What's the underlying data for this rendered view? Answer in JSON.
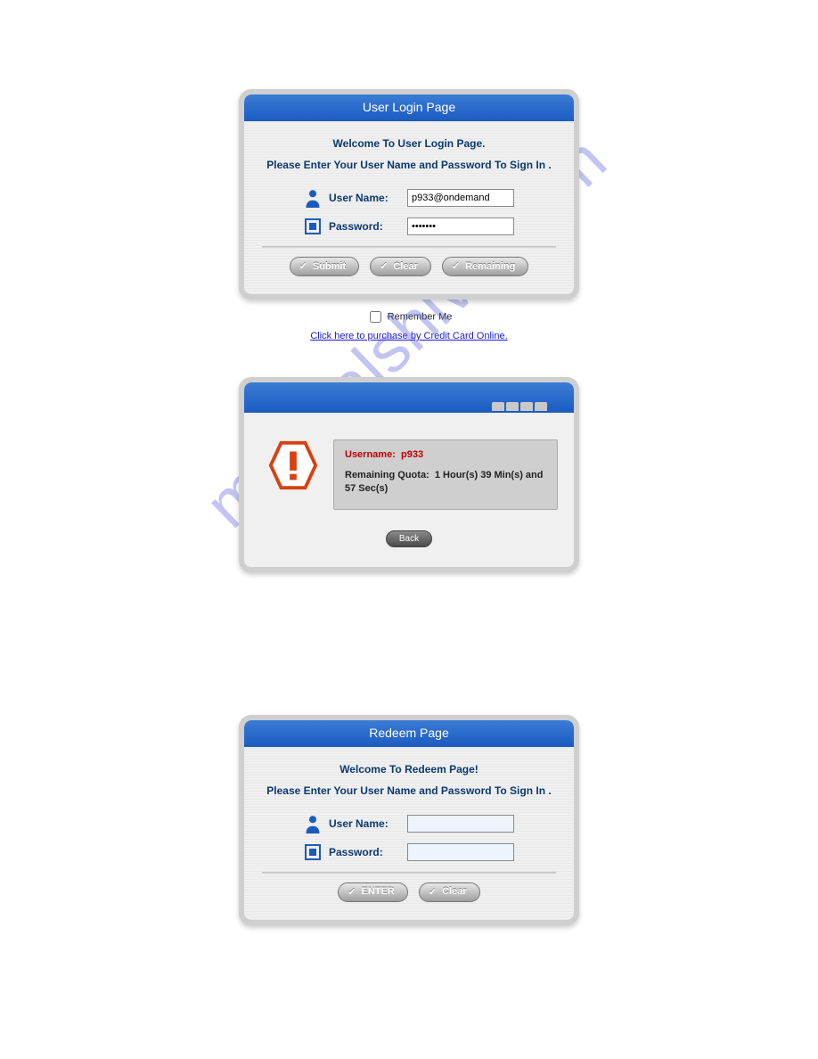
{
  "watermark": "manualshive.com",
  "panel1": {
    "title": "User Login Page",
    "welcome": "Welcome To User Login Page.",
    "instruction": "Please Enter Your User Name and Password To Sign In .",
    "username_label": "User Name:",
    "username_value": "p933@ondemand",
    "password_label": "Password:",
    "password_value": "•••••••",
    "submit_label": "Submit",
    "clear_label": "Clear",
    "remaining_label": "Remaining",
    "remember_label": "Remember Me",
    "purchase_link": "Click here to purchase by Credit Card Online."
  },
  "panel2": {
    "username_label": "Username:",
    "username_value": "p933",
    "quota_label": "Remaining Quota:",
    "quota_value": "1 Hour(s) 39 Min(s) and 57 Sec(s)",
    "back_label": "Back"
  },
  "panel3": {
    "title": "Redeem Page",
    "welcome": "Welcome To Redeem Page!",
    "instruction": "Please Enter Your User Name and Password To Sign In .",
    "username_label": "User Name:",
    "password_label": "Password:",
    "enter_label": "ENTER",
    "clear_label": "Clear"
  }
}
